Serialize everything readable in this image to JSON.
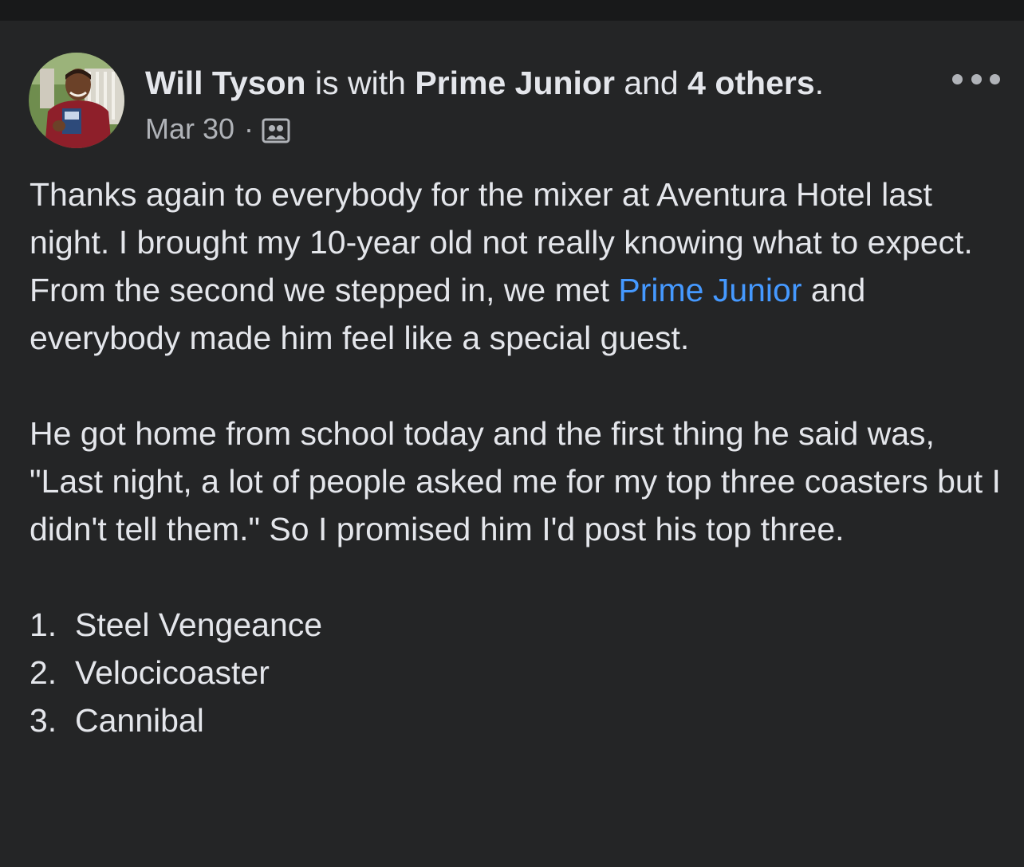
{
  "post": {
    "author": "Will Tyson",
    "is_with_text": " is with ",
    "tagged_person": "Prime Junior",
    "and_text": " and ",
    "others_text": "4 others",
    "period": ".",
    "date": "Mar 30",
    "separator": "·",
    "audience_icon": "friends-group-icon",
    "more_icon": "more-options-icon",
    "paragraph1_part1": "Thanks again to everybody for the mixer at Aventura Hotel last night.  I brought my 10-year old not really knowing what to expect.  From the second we stepped in, we met ",
    "paragraph1_mention": "Prime Junior",
    "paragraph1_part2": " and everybody made him feel like a special guest.",
    "paragraph2": "He got home from school today and the first thing he said was, \"Last night, a lot of people asked me for my top three coasters but I didn't tell them.\" So I promised him I'd post his top three.",
    "list": [
      {
        "num": "1.",
        "label": "Steel Vengeance"
      },
      {
        "num": "2.",
        "label": "Velocicoaster"
      },
      {
        "num": "3.",
        "label": "Cannibal"
      }
    ]
  },
  "colors": {
    "background": "#242526",
    "text": "#e4e6eb",
    "secondary_text": "#b0b3b8",
    "link": "#4599ff"
  }
}
